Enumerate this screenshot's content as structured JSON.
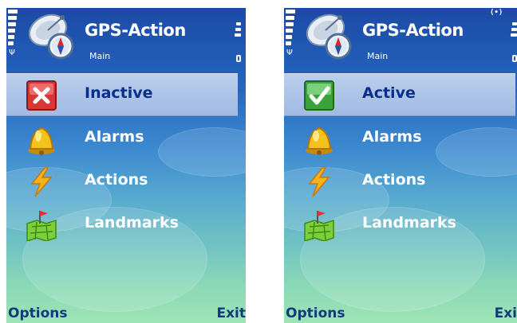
{
  "screens": [
    {
      "app_title": "GPS-Action",
      "subtitle": "Main",
      "show_bt": false,
      "menu": [
        {
          "label": "Inactive",
          "icon": "red-x-icon",
          "selected": true
        },
        {
          "label": "Alarms",
          "icon": "bell-icon",
          "selected": false
        },
        {
          "label": "Actions",
          "icon": "lightning-icon",
          "selected": false
        },
        {
          "label": "Landmarks",
          "icon": "landmark-map-icon",
          "selected": false
        }
      ],
      "softkeys": {
        "left": "Options",
        "right": "Exit"
      }
    },
    {
      "app_title": "GPS-Action",
      "subtitle": "Main",
      "show_bt": true,
      "bt_text": "(•)",
      "menu": [
        {
          "label": "Active",
          "icon": "green-check-icon",
          "selected": true
        },
        {
          "label": "Alarms",
          "icon": "bell-icon",
          "selected": false
        },
        {
          "label": "Actions",
          "icon": "lightning-icon",
          "selected": false
        },
        {
          "label": "Landmarks",
          "icon": "landmark-map-icon",
          "selected": false
        }
      ],
      "softkeys": {
        "left": "Options",
        "right": "Exi"
      }
    }
  ],
  "colors": {
    "selected_label": "#0a2f8a",
    "softkey_text": "#123a7a",
    "background_top": "#1b4aa6",
    "background_bottom": "#9ee4b6"
  }
}
